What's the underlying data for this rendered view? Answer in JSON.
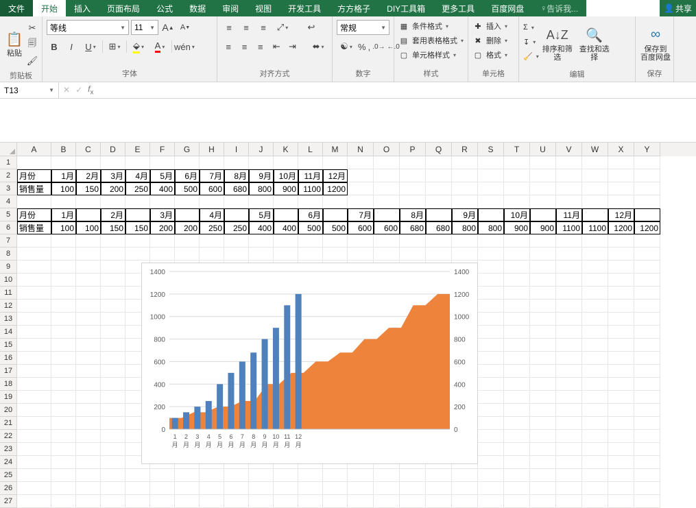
{
  "tabs": {
    "file": "文件",
    "start": "开始",
    "insert": "插入",
    "layout": "页面布局",
    "formula": "公式",
    "data": "数据",
    "review": "审阅",
    "view": "视图",
    "dev": "开发工具",
    "ff": "方方格子",
    "diy": "DIY工具箱",
    "more": "更多工具",
    "baidu": "百度网盘",
    "tell": "告诉我...",
    "share": "共享"
  },
  "ribbon": {
    "paste": "粘贴",
    "clipboard": "剪贴板",
    "fontname": "等线",
    "fontsize": "11",
    "fontgrp": "字体",
    "aligngrp": "对齐方式",
    "wrap": "",
    "merge": "",
    "numfmt": "常规",
    "numgrp": "数字",
    "condfmt": "条件格式",
    "tblfmt": "套用表格格式",
    "cellstyle": "单元格样式",
    "stylegrp": "样式",
    "ins": "插入",
    "del": "删除",
    "fmt": "格式",
    "cellgrp": "单元格",
    "sort": "排序和筛选",
    "find": "查找和选择",
    "editgrp": "编辑",
    "save": "保存到",
    "baidupan": "百度网盘",
    "savegrp": "保存"
  },
  "namebox": "T13",
  "cols": [
    "A",
    "B",
    "C",
    "D",
    "E",
    "F",
    "G",
    "H",
    "I",
    "J",
    "K",
    "L",
    "M",
    "N",
    "O",
    "P",
    "Q",
    "R",
    "S",
    "T",
    "U",
    "V",
    "W",
    "X",
    "Y"
  ],
  "table1": {
    "head": [
      "月份",
      "1月",
      "2月",
      "3月",
      "4月",
      "5月",
      "6月",
      "7月",
      "8月",
      "9月",
      "10月",
      "11月",
      "12月"
    ],
    "row": [
      "销售量",
      "100",
      "150",
      "200",
      "250",
      "400",
      "500",
      "600",
      "680",
      "800",
      "900",
      "1100",
      "1200"
    ]
  },
  "table2": {
    "head": [
      "月份",
      "1月",
      "",
      "2月",
      "",
      "3月",
      "",
      "4月",
      "",
      "5月",
      "",
      "6月",
      "",
      "7月",
      "",
      "8月",
      "",
      "9月",
      "",
      "10月",
      "",
      "11月",
      "",
      "12月",
      ""
    ],
    "row": [
      "销售量",
      "100",
      "100",
      "150",
      "150",
      "200",
      "200",
      "250",
      "250",
      "400",
      "400",
      "500",
      "500",
      "600",
      "600",
      "680",
      "680",
      "800",
      "800",
      "900",
      "900",
      "1100",
      "1100",
      "1200",
      "1200"
    ]
  },
  "chart_data": {
    "type": "combo",
    "series": [
      {
        "name": "bars",
        "type": "bar",
        "axis": "left",
        "categories": [
          "1月",
          "2月",
          "3月",
          "4月",
          "5月",
          "6月",
          "7月",
          "8月",
          "9月",
          "10月",
          "11月",
          "12月"
        ],
        "values": [
          100,
          150,
          200,
          250,
          400,
          500,
          600,
          680,
          800,
          900,
          1100,
          1200
        ]
      },
      {
        "name": "area",
        "type": "area",
        "axis": "right",
        "categories": [
          "1月",
          "1月",
          "2月",
          "2月",
          "3月",
          "3月",
          "4月",
          "4月",
          "5月",
          "5月",
          "6月",
          "6月",
          "7月",
          "7月",
          "8月",
          "8月",
          "9月",
          "9月",
          "10月",
          "10月",
          "11月",
          "11月",
          "12月",
          "12月"
        ],
        "values": [
          100,
          100,
          150,
          150,
          200,
          200,
          250,
          250,
          400,
          400,
          500,
          500,
          600,
          600,
          680,
          680,
          800,
          800,
          900,
          900,
          1100,
          1100,
          1200,
          1200
        ]
      }
    ],
    "ylim_left": [
      0,
      1400
    ],
    "yticks_left": [
      0,
      200,
      400,
      600,
      800,
      1000,
      1200,
      1400
    ],
    "ylim_right": [
      0,
      1400
    ],
    "yticks_right": [
      0,
      200,
      400,
      600,
      800,
      1000,
      1200,
      1400
    ],
    "xcats": [
      "1月",
      "2月",
      "3月",
      "4月",
      "5月",
      "6月",
      "7月",
      "8月",
      "9月",
      "10月",
      "11月",
      "12月"
    ]
  },
  "colors": {
    "bar": "#4f81bd",
    "area": "#ed7d31",
    "axis": "#d9d9d9",
    "text": "#595959"
  }
}
